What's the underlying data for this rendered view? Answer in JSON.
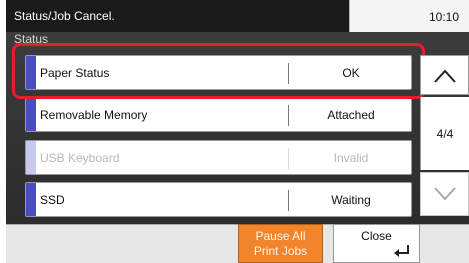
{
  "header": {
    "title": "Status/Job Cancel.",
    "subtitle": "Status",
    "time": "10:10"
  },
  "status_rows": [
    {
      "label": "Paper Status",
      "value": "OK",
      "enabled": true
    },
    {
      "label": "Removable Memory",
      "value": "Attached",
      "enabled": true
    },
    {
      "label": "USB Keyboard",
      "value": "Invalid",
      "enabled": false
    },
    {
      "label": "SSD",
      "value": "Waiting",
      "enabled": true
    }
  ],
  "pager": {
    "page_indicator": "4/4"
  },
  "footer": {
    "pause_label_line1": "Pause All",
    "pause_label_line2": "Print Jobs",
    "close_label": "Close"
  },
  "icons": {
    "up": "chevron-up-icon",
    "down": "chevron-down-icon",
    "enter": "enter-arrow-icon"
  },
  "colors": {
    "accent_tab": "#4b4ac8",
    "highlight": "#e61d2c",
    "pause_button": "#f2842c"
  }
}
